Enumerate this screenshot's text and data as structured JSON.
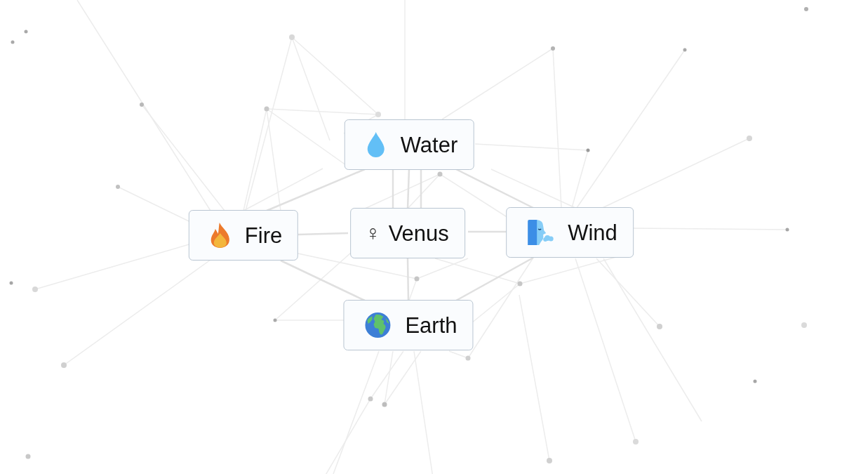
{
  "canvas": {
    "items": [
      {
        "kind": "drop",
        "label": "Water"
      },
      {
        "kind": "flame",
        "label": "Fire"
      },
      {
        "kind": "glyph",
        "glyph": "♀",
        "label": "Venus"
      },
      {
        "kind": "wind",
        "label": "Wind"
      },
      {
        "kind": "globe",
        "label": "Earth"
      }
    ]
  }
}
